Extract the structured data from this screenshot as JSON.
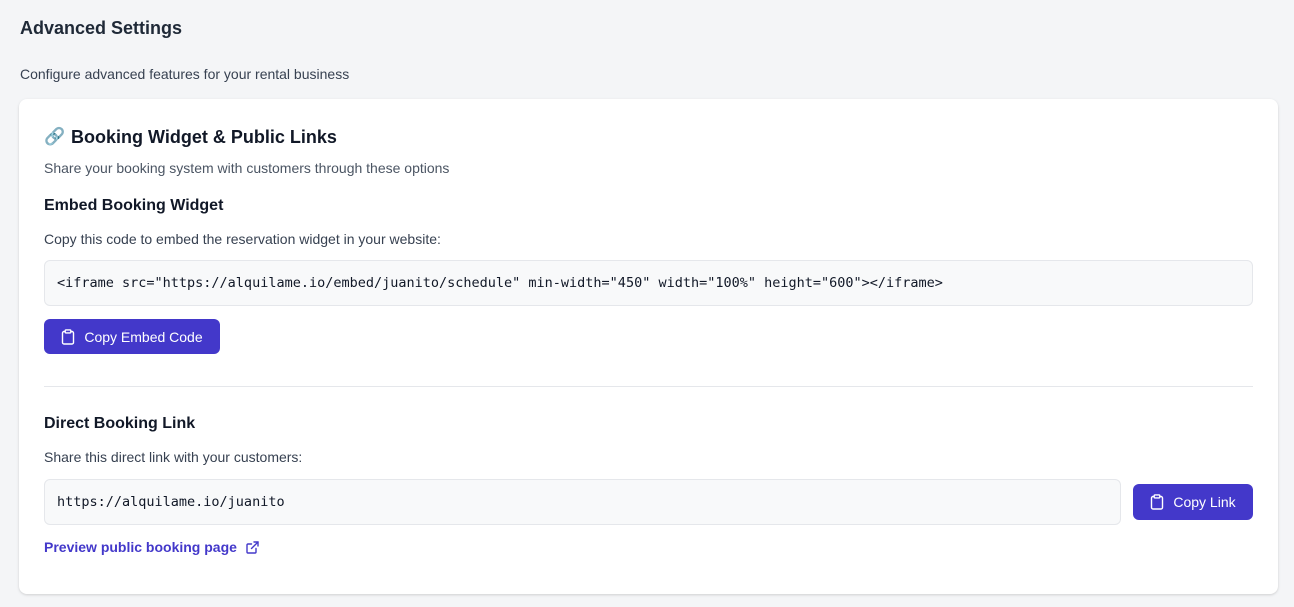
{
  "header": {
    "title": "Advanced Settings",
    "subtitle": "Configure advanced features for your rental business"
  },
  "card": {
    "icon": "link-emoji-icon",
    "icon_glyph": "🔗",
    "title": "Booking Widget & Public Links",
    "description": "Share your booking system with customers through these options"
  },
  "embed": {
    "title": "Embed Booking Widget",
    "description": "Copy this code to embed the reservation widget in your website:",
    "code": "<iframe src=\"https://alquilame.io/embed/juanito/schedule\" min-width=\"450\" width=\"100%\" height=\"600\"></iframe>",
    "button_label": "Copy Embed Code",
    "button_icon": "clipboard-icon"
  },
  "direct_link": {
    "title": "Direct Booking Link",
    "description": "Share this direct link with your customers:",
    "url": "https://alquilame.io/juanito",
    "button_label": "Copy Link",
    "button_icon": "clipboard-icon",
    "preview_label": "Preview public booking page",
    "preview_icon": "external-link-icon"
  },
  "colors": {
    "accent": "#4338ca",
    "background": "#f4f5f7",
    "card": "#ffffff",
    "code_bg": "#f8f9fa"
  }
}
